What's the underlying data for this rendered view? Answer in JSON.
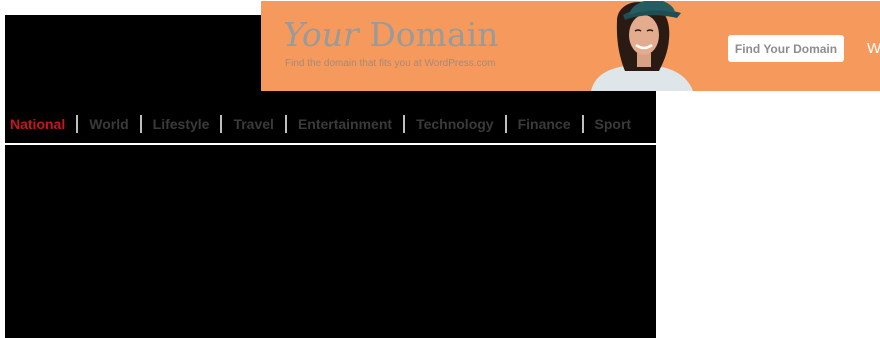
{
  "nav": {
    "items": [
      {
        "label": "National",
        "active": true
      },
      {
        "label": "World"
      },
      {
        "label": "Lifestyle"
      },
      {
        "label": "Travel"
      },
      {
        "label": "Entertainment"
      },
      {
        "label": "Technology"
      },
      {
        "label": "Finance"
      },
      {
        "label": "Sport"
      }
    ]
  },
  "ad": {
    "title_part1": "Your",
    "title_part2": "Domain",
    "tagline": "Find the domain that fits you at WordPress.com",
    "cta_label": "Find Your Domain",
    "trailing_text": "W"
  },
  "colors": {
    "header_bg": "#000000",
    "nav_active": "#c5161d",
    "nav_text": "#3a3a3a",
    "ad_bg": "#f59a5c"
  }
}
